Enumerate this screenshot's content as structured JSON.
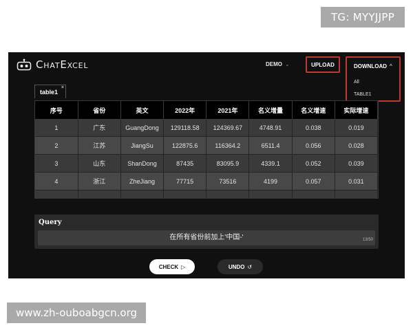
{
  "badge": "TG: MYYJJPP",
  "watermark": "www.zh-ouboabgcn.org",
  "header": {
    "brand": "ChatExcel",
    "demo_label": "DEMO",
    "upload_label": "UPLOAD",
    "download_label": "DOWNLOAD",
    "download_options": [
      "All",
      "TABLE1"
    ]
  },
  "tab": {
    "label": "table1",
    "close": "×"
  },
  "table": {
    "columns": [
      "序号",
      "省份",
      "英文",
      "2022年",
      "2021年",
      "名义增量",
      "名义增速",
      "实际增速"
    ],
    "rows": [
      [
        "1",
        "广东",
        "GuangDong",
        "129118.58",
        "124369.67",
        "4748.91",
        "0.038",
        "0.019"
      ],
      [
        "2",
        "江苏",
        "JiangSu",
        "122875.6",
        "116364.2",
        "6511.4",
        "0.056",
        "0.028"
      ],
      [
        "3",
        "山东",
        "ShanDong",
        "87435",
        "83095.9",
        "4339.1",
        "0.052",
        "0.039"
      ],
      [
        "4",
        "浙江",
        "ZheJiang",
        "77715",
        "73516",
        "4199",
        "0.057",
        "0.031"
      ]
    ]
  },
  "query": {
    "title": "Query",
    "value": "在所有省份前加上'中国-'",
    "count": "13/50"
  },
  "actions": {
    "check_label": "CHECK",
    "undo_label": "UNDO"
  }
}
